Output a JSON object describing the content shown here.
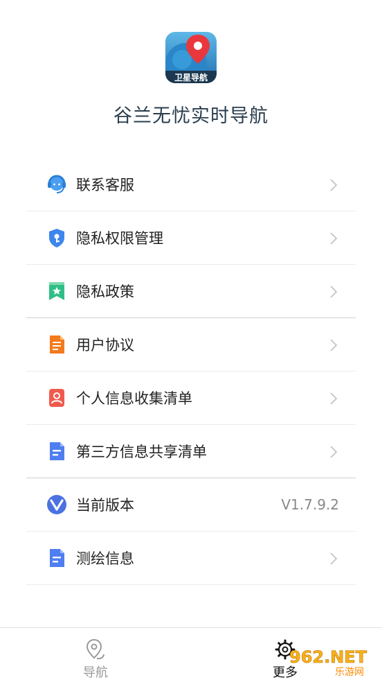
{
  "app": {
    "icon_label": "卫星导航",
    "name": "谷兰无忧实时导航"
  },
  "menu": {
    "items": [
      {
        "label": "联系客服",
        "icon": "customer-service-icon"
      },
      {
        "label": "隐私权限管理",
        "icon": "shield-key-icon"
      },
      {
        "label": "隐私政策",
        "icon": "bookmark-star-icon"
      },
      {
        "label": "用户协议",
        "icon": "document-orange-icon"
      },
      {
        "label": "个人信息收集清单",
        "icon": "person-card-icon"
      },
      {
        "label": "第三方信息共享清单",
        "icon": "document-blue-icon"
      },
      {
        "label": "当前版本",
        "icon": "version-v-icon",
        "value": "V1.7.9.2"
      },
      {
        "label": "测绘信息",
        "icon": "document-blue-icon"
      }
    ]
  },
  "tabbar": {
    "tabs": [
      {
        "label": "导航",
        "icon": "location-pin-icon",
        "active": false
      },
      {
        "label": "更多",
        "icon": "gear-icon",
        "active": true
      }
    ]
  },
  "watermark": {
    "brand": "962.NET",
    "subtitle": "乐游网"
  },
  "colors": {
    "primary_text": "#222222",
    "title_text": "#2a3d4d",
    "muted": "#9a9a9a",
    "accent_red": "#e8383d",
    "accent_blue": "#4f7ef0",
    "accent_orange": "#f47a1e",
    "accent_green": "#2fbf86"
  }
}
